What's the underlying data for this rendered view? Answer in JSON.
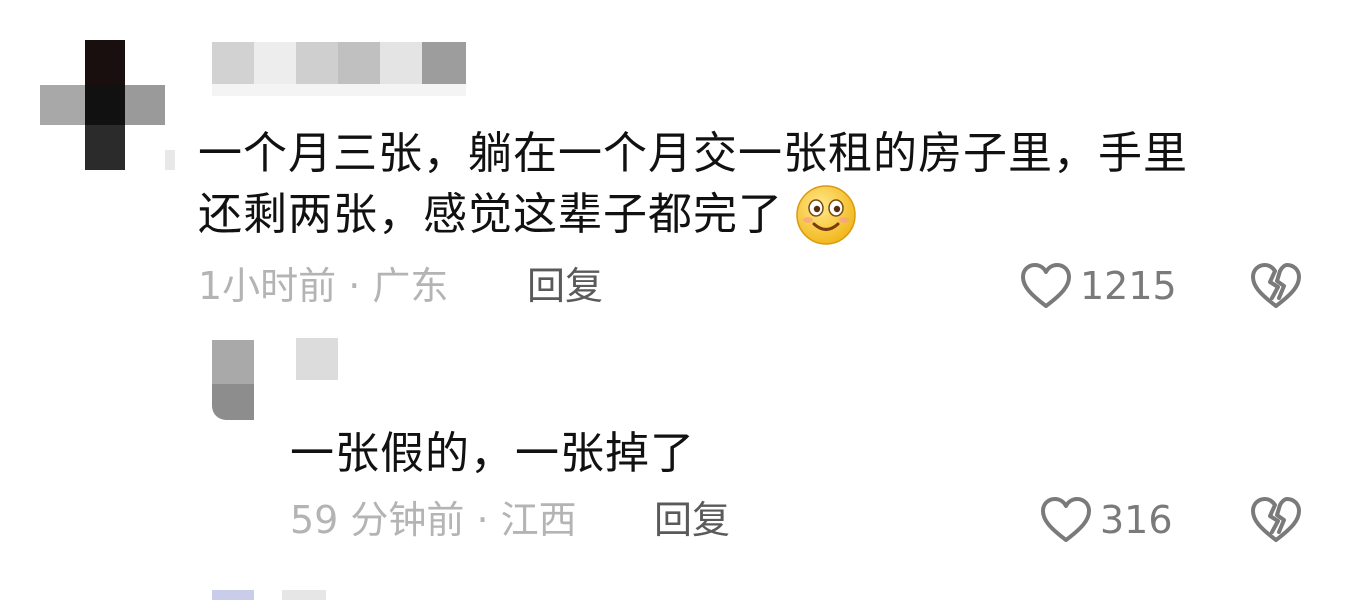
{
  "comments": [
    {
      "text_line1": "一个月三张，躺在一个月交一张租的房子里，手里",
      "text_line2": "还剩两张，感觉这辈子都完了",
      "emoji": "smile-emoji",
      "time_location": "1小时前 · 广东",
      "reply_label": "回复",
      "like_count": "1215"
    },
    {
      "text": "一张假的，一张掉了",
      "time_location": "59 分钟前 · 江西",
      "reply_label": "回复",
      "like_count": "316"
    }
  ],
  "icons": {
    "like": "heart-outline-icon",
    "dislike": "broken-heart-icon"
  },
  "colors": {
    "text": "#111111",
    "meta": "#b4b4b4",
    "reply": "#5a5a5a",
    "icon": "#7a7a7a"
  }
}
